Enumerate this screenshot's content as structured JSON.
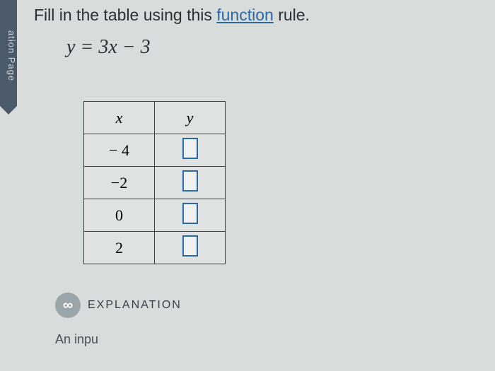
{
  "side_tab": "ation Page",
  "instruction": {
    "pre": "Fill in the table using this ",
    "link": "function",
    "post": " rule."
  },
  "equation": "y = 3x − 3",
  "table": {
    "headers": {
      "x": "x",
      "y": "y"
    },
    "rows": [
      {
        "x": "− 4",
        "y": ""
      },
      {
        "x": "−2",
        "y": ""
      },
      {
        "x": "0",
        "y": ""
      },
      {
        "x": "2",
        "y": ""
      }
    ]
  },
  "explanation": {
    "icon": "∞",
    "label": "EXPLANATION"
  },
  "cutoff_text": "An inpu"
}
